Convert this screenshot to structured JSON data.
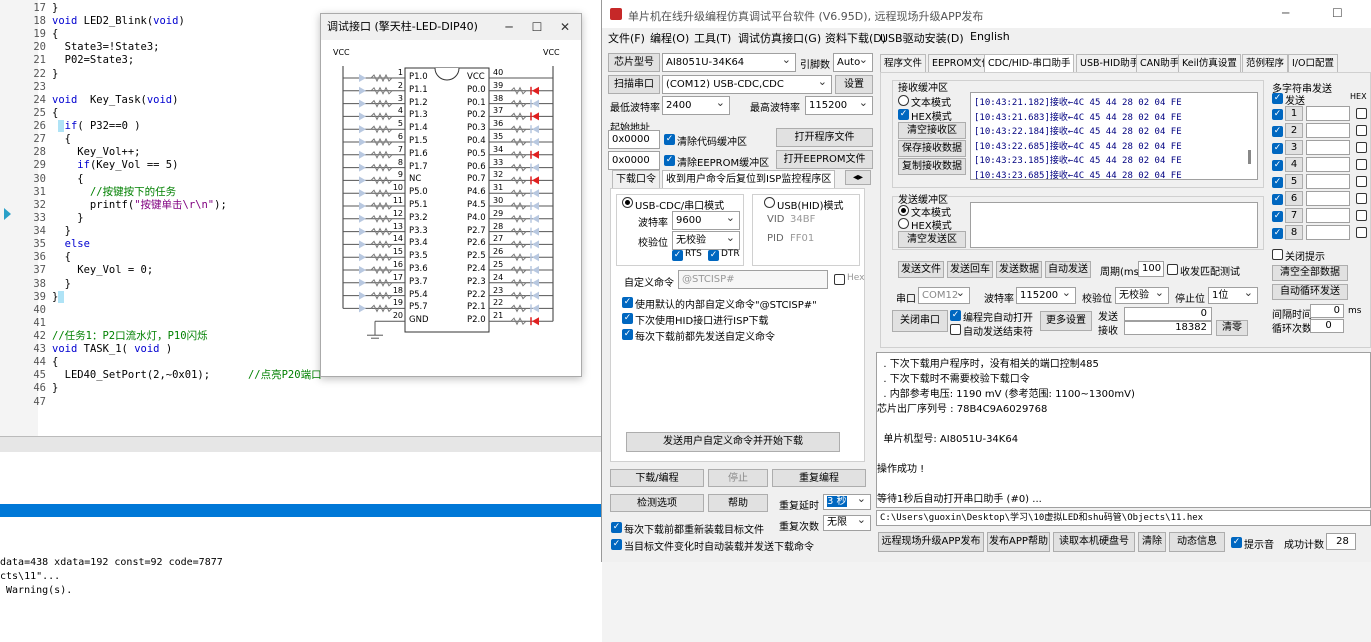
{
  "ide": {
    "code_lines": [
      {
        "n": "17",
        "t": "}"
      },
      {
        "n": "18",
        "t": "void LED2_Blink(void)"
      },
      {
        "n": "19",
        "t": "{"
      },
      {
        "n": "20",
        "t": "  State3=!State3;"
      },
      {
        "n": "21",
        "t": "  P02=State3;"
      },
      {
        "n": "22",
        "t": "}"
      },
      {
        "n": "23",
        "t": ""
      },
      {
        "n": "24",
        "t": "void  Key_Task(void)"
      },
      {
        "n": "25",
        "t": "{"
      },
      {
        "n": "26",
        "t": "  if( P32==0 )"
      },
      {
        "n": "27",
        "t": "  {"
      },
      {
        "n": "28",
        "t": "    Key_Vol++;"
      },
      {
        "n": "29",
        "t": "    if(Key_Vol == 5)"
      },
      {
        "n": "30",
        "t": "    {"
      },
      {
        "n": "31",
        "t": "      //按键按下的任务"
      },
      {
        "n": "32",
        "t": "      printf(\"按键单击\\r\\n\");"
      },
      {
        "n": "33",
        "t": "    }"
      },
      {
        "n": "34",
        "t": "  }"
      },
      {
        "n": "35",
        "t": "  else"
      },
      {
        "n": "36",
        "t": "  {"
      },
      {
        "n": "37",
        "t": "    Key_Vol = 0;"
      },
      {
        "n": "38",
        "t": "  }"
      },
      {
        "n": "39",
        "t": "}"
      },
      {
        "n": "40",
        "t": ""
      },
      {
        "n": "41",
        "t": ""
      },
      {
        "n": "42",
        "t": "//任务1：P2口流水灯，P10闪烁"
      },
      {
        "n": "43",
        "t": "void TASK_1( void )"
      },
      {
        "n": "44",
        "t": "{"
      },
      {
        "n": "45",
        "t": "  LED40_SetPort(2,~0x01);      //点亮P20端口"
      },
      {
        "n": "46",
        "t": "}"
      },
      {
        "n": "47",
        "t": ""
      }
    ],
    "output_lines": [
      "data=438 xdata=192 const=92 code=7877",
      "cts\\11\"...",
      " Warning(s)."
    ]
  },
  "debug_window": {
    "title": "调试接口 (擎天柱-LED-DIP40)",
    "vcc_left": "VCC",
    "vcc_right": "VCC",
    "left_pins": [
      {
        "num": "1",
        "name": "P1.0"
      },
      {
        "num": "2",
        "name": "P1.1"
      },
      {
        "num": "3",
        "name": "P1.2"
      },
      {
        "num": "4",
        "name": "P1.3"
      },
      {
        "num": "5",
        "name": "P1.4"
      },
      {
        "num": "6",
        "name": "P1.5"
      },
      {
        "num": "7",
        "name": "P1.6"
      },
      {
        "num": "8",
        "name": "P1.7"
      },
      {
        "num": "9",
        "name": "NC"
      },
      {
        "num": "10",
        "name": "P5.0"
      },
      {
        "num": "11",
        "name": "P5.1"
      },
      {
        "num": "12",
        "name": "P3.2"
      },
      {
        "num": "13",
        "name": "P3.3"
      },
      {
        "num": "14",
        "name": "P3.4"
      },
      {
        "num": "15",
        "name": "P3.5"
      },
      {
        "num": "16",
        "name": "P3.6"
      },
      {
        "num": "17",
        "name": "P3.7"
      },
      {
        "num": "18",
        "name": "P5.4"
      },
      {
        "num": "19",
        "name": "P5.7"
      },
      {
        "num": "20",
        "name": "GND"
      }
    ],
    "right_pins": [
      {
        "num": "40",
        "name": "VCC",
        "led": "none"
      },
      {
        "num": "39",
        "name": "P0.0",
        "led": "red"
      },
      {
        "num": "38",
        "name": "P0.1",
        "led": "off"
      },
      {
        "num": "37",
        "name": "P0.2",
        "led": "red"
      },
      {
        "num": "36",
        "name": "P0.3",
        "led": "off"
      },
      {
        "num": "35",
        "name": "P0.4",
        "led": "off"
      },
      {
        "num": "34",
        "name": "P0.5",
        "led": "red"
      },
      {
        "num": "33",
        "name": "P0.6",
        "led": "off"
      },
      {
        "num": "32",
        "name": "P0.7",
        "led": "red"
      },
      {
        "num": "31",
        "name": "P4.6",
        "led": "off"
      },
      {
        "num": "30",
        "name": "P4.5",
        "led": "off"
      },
      {
        "num": "29",
        "name": "P4.0",
        "led": "off"
      },
      {
        "num": "28",
        "name": "P2.7",
        "led": "off"
      },
      {
        "num": "27",
        "name": "P2.6",
        "led": "off"
      },
      {
        "num": "26",
        "name": "P2.5",
        "led": "off"
      },
      {
        "num": "25",
        "name": "P2.4",
        "led": "off"
      },
      {
        "num": "24",
        "name": "P2.3",
        "led": "off"
      },
      {
        "num": "23",
        "name": "P2.2",
        "led": "off"
      },
      {
        "num": "22",
        "name": "P2.1",
        "led": "off"
      },
      {
        "num": "21",
        "name": "P2.0",
        "led": "red"
      }
    ],
    "led_red": "#e02020",
    "led_off": "#b8c8e0"
  },
  "stc": {
    "title": "单片机在线升级编程仿真调试平台软件 (V6.95D), 远程现场升级APP发布",
    "menu": [
      "文件(F)",
      "编程(O)",
      "工具(T)",
      "调试仿真接口(G)",
      "资料下载(D)",
      "USB驱动安装(D)",
      "English"
    ],
    "chip_label": "芯片型号",
    "chip_value": "AI8051U-34K64",
    "freq_label": "引脚数",
    "freq_value": "Auto",
    "scan_label": "扫描串口",
    "port_value": "(COM12) USB-CDC,CDC",
    "settings_label": "设置",
    "min_baud_label": "最低波特率",
    "min_baud": "2400",
    "max_baud_label": "最高波特率",
    "max_baud": "115200",
    "start_addr_label": "起始地址",
    "addr1": "0x0000",
    "clear_code": "清除代码缓冲区",
    "open_prog": "打开程序文件",
    "addr2": "0x0000",
    "clear_eeprom": "清除EEPROM缓冲区",
    "open_eeprom": "打开EEPROM文件",
    "dl_tabs": [
      "下载口令",
      "收到用户命令后复位到ISP监控程序区"
    ],
    "usb_cdc_mode": "USB-CDC/串口模式",
    "usb_hid_mode": "USB(HID)模式",
    "baud_label": "波特率",
    "baud_value": "9600",
    "parity_label": "校验位",
    "parity_value": "无校验",
    "rts": "RTS",
    "dtr": "DTR",
    "vid_label": "VID",
    "vid": "34BF",
    "pid_label": "PID",
    "pid": "FF01",
    "custom_cmd_label": "自定义命令",
    "custom_cmd": "@STCISP#",
    "hex_label": "Hex",
    "opt1": "使用默认的内部自定义命令\"@STCISP#\"",
    "opt2": "下次使用HID接口进行ISP下载",
    "opt3": "每次下载前都先发送自定义命令",
    "send_cmd_btn": "发送用户自定义命令并开始下载",
    "download_btn": "下载/编程",
    "stop_btn": "停止",
    "reprog_btn": "重复编程",
    "check_btn": "检测选项",
    "help_btn": "帮助",
    "delay_label": "重复延时",
    "delay_value": "3 秒",
    "repeat_label": "重复次数",
    "repeat_value": "无限",
    "reload_opt": "每次下载前都重新装载目标文件",
    "auto_opt": "当目标文件变化时自动装载并发送下载命令",
    "right_tabs": [
      "程序文件",
      "EEPROM文件",
      "CDC/HID-串口助手",
      "USB-HID助手",
      "CAN助手",
      "Keil仿真设置",
      "范例程序",
      "I/O口配置"
    ],
    "rx_title": "接收缓冲区",
    "rx_text_mode": "文本模式",
    "rx_hex_mode": "HEX模式",
    "clear_rx": "清空接收区",
    "save_rx": "保存接收数据",
    "copy_rx": "复制接收数据",
    "rx_lines": [
      "[10:43:21.182]接收←4C 45 44 28 02 04 FE",
      "[10:43:21.683]接收←4C 45 44 28 02 04 FE",
      "[10:43:22.184]接收←4C 45 44 28 02 04 FE",
      "[10:43:22.685]接收←4C 45 44 28 02 04 FE",
      "[10:43:23.185]接收←4C 45 44 28 02 04 FE",
      "[10:43:23.685]接收←4C 45 44 28 02 04 FE"
    ],
    "tx_title": "发送缓冲区",
    "tx_text_mode": "文本模式",
    "tx_hex_mode": "HEX模式",
    "clear_tx": "清空发送区",
    "send_file": "发送文件",
    "send_enter": "发送回车",
    "send_data": "发送数据",
    "auto_send": "自动发送",
    "period_label": "周期(ms)",
    "period_value": "100",
    "match_label": "收发匹配测试",
    "port_label": "串口",
    "port2_value": "COM12",
    "baud2_label": "波特率",
    "baud2_value": "115200",
    "parity2_label": "校验位",
    "parity2_value": "无校验",
    "stop_label": "停止位",
    "stop_value": "1位",
    "close_port": "关闭串口",
    "auto_open": "编程完自动打开",
    "auto_end": "自动发送结束符",
    "more_settings": "更多设置",
    "send_count_label": "发送",
    "send_count": "0",
    "recv_count_label": "接收",
    "recv_count": "18382",
    "clear_count": "清零",
    "multi_title": "多字符串发送",
    "multi_send": "发送",
    "multi_hex": "HEX",
    "multi_rows": [
      "1",
      "2",
      "3",
      "4",
      "5",
      "6",
      "7",
      "8"
    ],
    "close_tip": "关闭提示",
    "clear_all": "清空全部数据",
    "auto_loop": "自动循环发送",
    "interval_label": "间隔时间",
    "interval_value": "0",
    "interval_unit": "ms",
    "loop_label": "循环次数",
    "loop_value": "0",
    "log_lines": [
      "  . 下次下载用户程序时，没有相关的端口控制485",
      "  . 下次下载时不需要校验下载口令",
      "  . 内部参考电压: 1190 mV (参考范围: 1100~1300mV)",
      "芯片出厂序列号 : 78B4C9A6029768",
      "",
      "  单片机型号: AI8051U-34K64",
      "",
      "操作成功 !",
      "",
      "等待1秒后自动打开串口助手 (#0) ..."
    ],
    "file_path": "C:\\Users\\guoxin\\Desktop\\学习\\10虚拟LED和shu码管\\Objects\\11.hex",
    "bottom_btns": [
      "远程现场升级APP发布",
      "发布APP帮助",
      "读取本机硬盘号",
      "清除",
      "动态信息"
    ],
    "beep": "提示音",
    "success_label": "成功计数",
    "success_value": "28"
  }
}
